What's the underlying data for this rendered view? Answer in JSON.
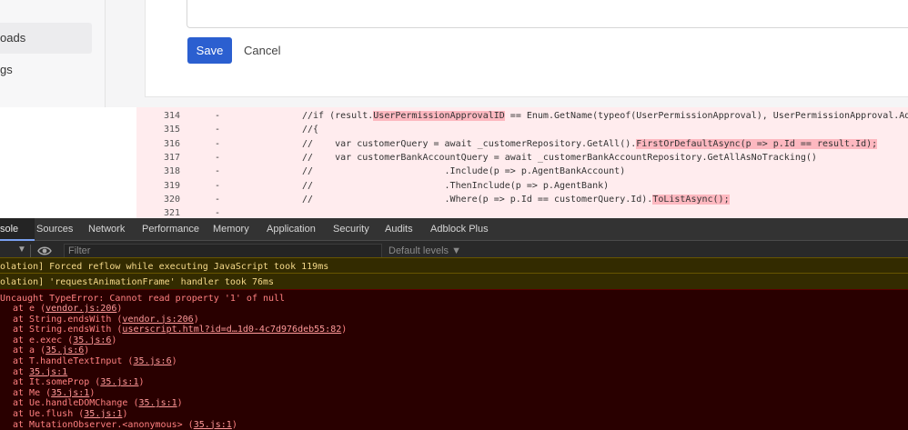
{
  "sidebar": {
    "items": [
      {
        "label": "oads",
        "active": true
      },
      {
        "label": "gs",
        "active": false
      }
    ]
  },
  "form": {
    "save_label": "Save",
    "cancel_label": "Cancel"
  },
  "colors": {
    "primary_button": "#2b5fd0",
    "diff_removed_bg": "#ffecee",
    "diff_highlight": "#fdb8c0",
    "console_error_bg": "#290000",
    "console_warning_bg": "#332b00"
  },
  "diff": {
    "rows": [
      {
        "num": "314",
        "sign": "-",
        "pre": "//if (result.",
        "hl": "UserPermissionApprovalID",
        "post": " == Enum.GetName(typeof(UserPermissionApproval), UserPermissionApproval.Add_Cust"
      },
      {
        "num": "315",
        "sign": "-",
        "pre": "//{",
        "hl": "",
        "post": ""
      },
      {
        "num": "316",
        "sign": "-",
        "pre": "//    var customerQuery = await _customerRepository.GetAll().",
        "hl": "FirstOrDefaultAsync(p => p.Id == result.Id);",
        "post": ""
      },
      {
        "num": "317",
        "sign": "-",
        "pre": "//    var customerBankAccountQuery = await _customerBankAccountRepository.GetAllAsNoTracking()",
        "hl": "",
        "post": ""
      },
      {
        "num": "318",
        "sign": "-",
        "pre": "//                        .Include(p => p.AgentBankAccount)",
        "hl": "",
        "post": ""
      },
      {
        "num": "319",
        "sign": "-",
        "pre": "//                        .ThenInclude(p => p.AgentBank)",
        "hl": "",
        "post": ""
      },
      {
        "num": "320",
        "sign": "-",
        "pre": "//                        .Where(p => p.Id == customerQuery.Id).",
        "hl": "ToListAsync();",
        "post": ""
      },
      {
        "num": "321",
        "sign": "-",
        "pre": "",
        "hl": "",
        "post": ""
      }
    ]
  },
  "devtools": {
    "tabs": [
      {
        "label": "sole",
        "active": true
      },
      {
        "label": "Sources"
      },
      {
        "label": "Network"
      },
      {
        "label": "Performance"
      },
      {
        "label": "Memory"
      },
      {
        "label": "Application"
      },
      {
        "label": "Security"
      },
      {
        "label": "Audits"
      },
      {
        "label": "Adblock Plus"
      }
    ],
    "toolbar": {
      "filter_placeholder": "Filter",
      "levels_label": "Default levels ▼"
    },
    "warnings": [
      "olation] Forced reflow while executing JavaScript took 119ms",
      "olation] 'requestAnimationFrame' handler took 76ms"
    ],
    "error": {
      "message": "Uncaught TypeError: Cannot read property '1' of null",
      "stack": [
        {
          "text": "at e (",
          "link": "vendor.js:206",
          "end": ")"
        },
        {
          "text": "at String.endsWith (",
          "link": "vendor.js:206",
          "end": ")"
        },
        {
          "text": "at String.endsWith (",
          "link": "userscript.html?id=d…1d0-4c7d976deb55:82",
          "end": ")"
        },
        {
          "text": "at e.exec (",
          "link": "35.js:6",
          "end": ")"
        },
        {
          "text": "at a (",
          "link": "35.js:6",
          "end": ")"
        },
        {
          "text": "at T.handleTextInput (",
          "link": "35.js:6",
          "end": ")"
        },
        {
          "text": "at ",
          "link": "35.js:1",
          "end": ""
        },
        {
          "text": "at It.someProp (",
          "link": "35.js:1",
          "end": ")"
        },
        {
          "text": "at Me (",
          "link": "35.js:1",
          "end": ")"
        },
        {
          "text": "at Ue.handleDOMChange (",
          "link": "35.js:1",
          "end": ")"
        },
        {
          "text": "at Ue.flush (",
          "link": "35.js:1",
          "end": ")"
        },
        {
          "text": "at MutationObserver.<anonymous> (",
          "link": "35.js:1",
          "end": ")"
        }
      ]
    }
  }
}
